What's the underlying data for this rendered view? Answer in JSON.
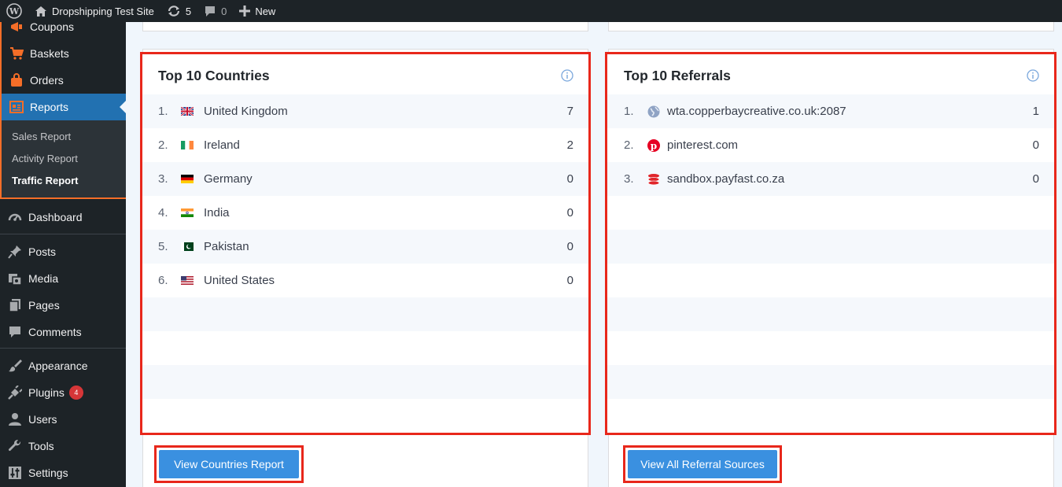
{
  "adminbar": {
    "site_name": "Dropshipping Test Site",
    "updates_count": "5",
    "comments_count": "0",
    "new_label": "New"
  },
  "sidebar": {
    "woo_items": [
      {
        "label": "Coupons",
        "icon": "megaphone-icon"
      },
      {
        "label": "Baskets",
        "icon": "cart-icon"
      },
      {
        "label": "Orders",
        "icon": "bag-icon"
      },
      {
        "label": "Reports",
        "icon": "report-icon"
      }
    ],
    "report_submenu": [
      {
        "label": "Sales Report"
      },
      {
        "label": "Activity Report"
      },
      {
        "label": "Traffic Report"
      }
    ],
    "main_items": [
      {
        "label": "Dashboard"
      },
      {
        "label": "Posts"
      },
      {
        "label": "Media"
      },
      {
        "label": "Pages"
      },
      {
        "label": "Comments"
      },
      {
        "label": "Appearance"
      },
      {
        "label": "Plugins",
        "badge": "4"
      },
      {
        "label": "Users"
      },
      {
        "label": "Tools"
      },
      {
        "label": "Settings"
      }
    ]
  },
  "countries": {
    "title": "Top 10 Countries",
    "rows": [
      {
        "rank": "1.",
        "name": "United Kingdom",
        "count": "7",
        "flag": "uk"
      },
      {
        "rank": "2.",
        "name": "Ireland",
        "count": "2",
        "flag": "ie"
      },
      {
        "rank": "3.",
        "name": "Germany",
        "count": "0",
        "flag": "de"
      },
      {
        "rank": "4.",
        "name": "India",
        "count": "0",
        "flag": "in"
      },
      {
        "rank": "5.",
        "name": "Pakistan",
        "count": "0",
        "flag": "pk"
      },
      {
        "rank": "6.",
        "name": "United States",
        "count": "0",
        "flag": "us"
      }
    ],
    "button_label": "View Countries Report"
  },
  "referrals": {
    "title": "Top 10 Referrals",
    "rows": [
      {
        "rank": "1.",
        "name": "wta.copperbaycreative.co.uk:2087",
        "count": "1",
        "icon": "globe-icon"
      },
      {
        "rank": "2.",
        "name": "pinterest.com",
        "count": "0",
        "icon": "pinterest-icon"
      },
      {
        "rank": "3.",
        "name": "sandbox.payfast.co.za",
        "count": "0",
        "icon": "payfast-icon"
      }
    ],
    "button_label": "View All Referral Sources"
  },
  "colors": {
    "highlight": "#e8271b",
    "button": "#3a90e0",
    "admin_dark": "#1d2327",
    "active_menu": "#2271b1",
    "woo_accent": "#f56e28"
  }
}
